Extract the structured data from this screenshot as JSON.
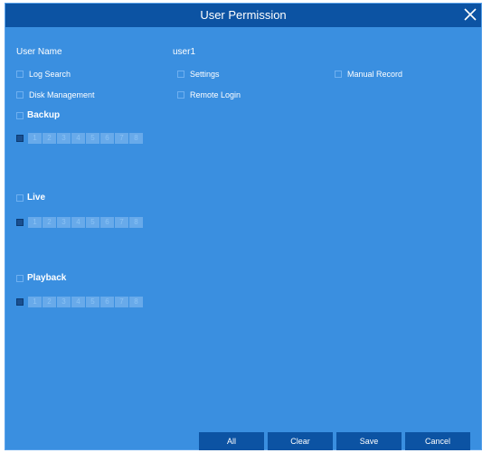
{
  "dialog": {
    "title": "User Permission"
  },
  "user": {
    "label": "User Name",
    "value": "user1"
  },
  "permissions": [
    {
      "label": "Log Search"
    },
    {
      "label": "Settings"
    },
    {
      "label": "Manual Record"
    },
    {
      "label": "Disk Management"
    },
    {
      "label": "Remote Login"
    }
  ],
  "sections": [
    {
      "label": "Backup",
      "channels": [
        "1",
        "2",
        "3",
        "4",
        "5",
        "6",
        "7",
        "8"
      ]
    },
    {
      "label": "Live",
      "channels": [
        "1",
        "2",
        "3",
        "4",
        "5",
        "6",
        "7",
        "8"
      ]
    },
    {
      "label": "Playback",
      "channels": [
        "1",
        "2",
        "3",
        "4",
        "5",
        "6",
        "7",
        "8"
      ]
    }
  ],
  "buttons": {
    "all": "All",
    "clear": "Clear",
    "save": "Save",
    "cancel": "Cancel"
  }
}
